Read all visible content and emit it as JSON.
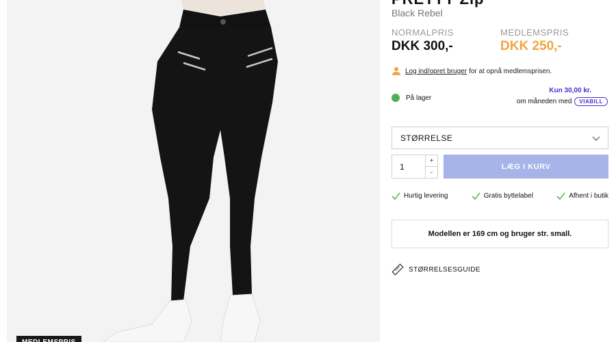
{
  "product": {
    "title": "PRETTY Zip",
    "brand": "Black Rebel",
    "image_badge": "MEDLEMSPRIS"
  },
  "prices": {
    "normal_label": "NORMALPRIS",
    "normal_value": "DKK 300,-",
    "member_label": "MEDLEMSPRIS",
    "member_value": "DKK 250,-",
    "member_color": "#f0a541"
  },
  "login": {
    "icon": "user-icon",
    "link_text": "Log ind/opret bruger",
    "rest_text": "for at opnå medlemsprisen."
  },
  "stock": {
    "label": "På lager",
    "status_color": "#4caf50"
  },
  "financing": {
    "amount": "Kun 30,00 kr.",
    "per_month": "om måneden med",
    "provider": "VIABILL",
    "brand_color": "#4b2ccc"
  },
  "size_select": {
    "label": "STØRRELSE",
    "icon": "chevron-down-icon"
  },
  "cart": {
    "quantity": "1",
    "plus": "+",
    "minus": "-",
    "add_label": "LÆG I KURV",
    "button_color": "#a6b4e8"
  },
  "usps": [
    {
      "icon": "checkmark-icon",
      "label": "Hurtig levering"
    },
    {
      "icon": "checkmark-icon",
      "label": "Gratis byttelabel"
    },
    {
      "icon": "checkmark-icon",
      "label": "Afhent i butik"
    }
  ],
  "model_info": "Modellen er 169 cm og bruger str. small.",
  "size_guide": {
    "icon": "ruler-icon",
    "label": "STØRRELSESGUIDE"
  }
}
